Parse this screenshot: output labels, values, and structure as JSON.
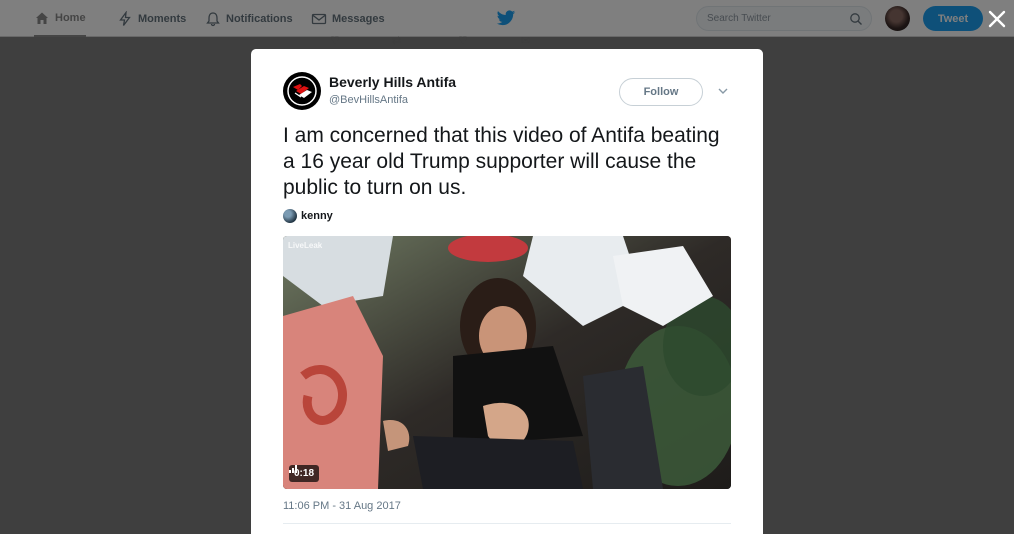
{
  "nav": {
    "home_label": "Home",
    "moments_label": "Moments",
    "notifications_label": "Notifications",
    "messages_label": "Messages",
    "search_placeholder": "Search Twitter",
    "tweet_button_label": "Tweet",
    "brand_color": "#1da1f2"
  },
  "tweet": {
    "author_name": "Beverly Hills Antifa",
    "author_handle": "@BevHillsAntifa",
    "follow_label": "Follow",
    "text": "I am concerned that this video of Antifa beating a 16 year old Trump supporter will cause the public to turn on us.",
    "mention_name": "kenny",
    "video_watermark": "LiveLeak",
    "video_duration": "0:18",
    "timestamp": "11:06 PM - 31 Aug 2017"
  },
  "icons": {
    "home": "home-icon",
    "moments": "lightning-icon",
    "notifications": "bell-icon",
    "messages": "envelope-icon",
    "search": "search-icon",
    "close": "close-icon",
    "caret": "chevron-down-icon",
    "volume": "volume-icon"
  }
}
